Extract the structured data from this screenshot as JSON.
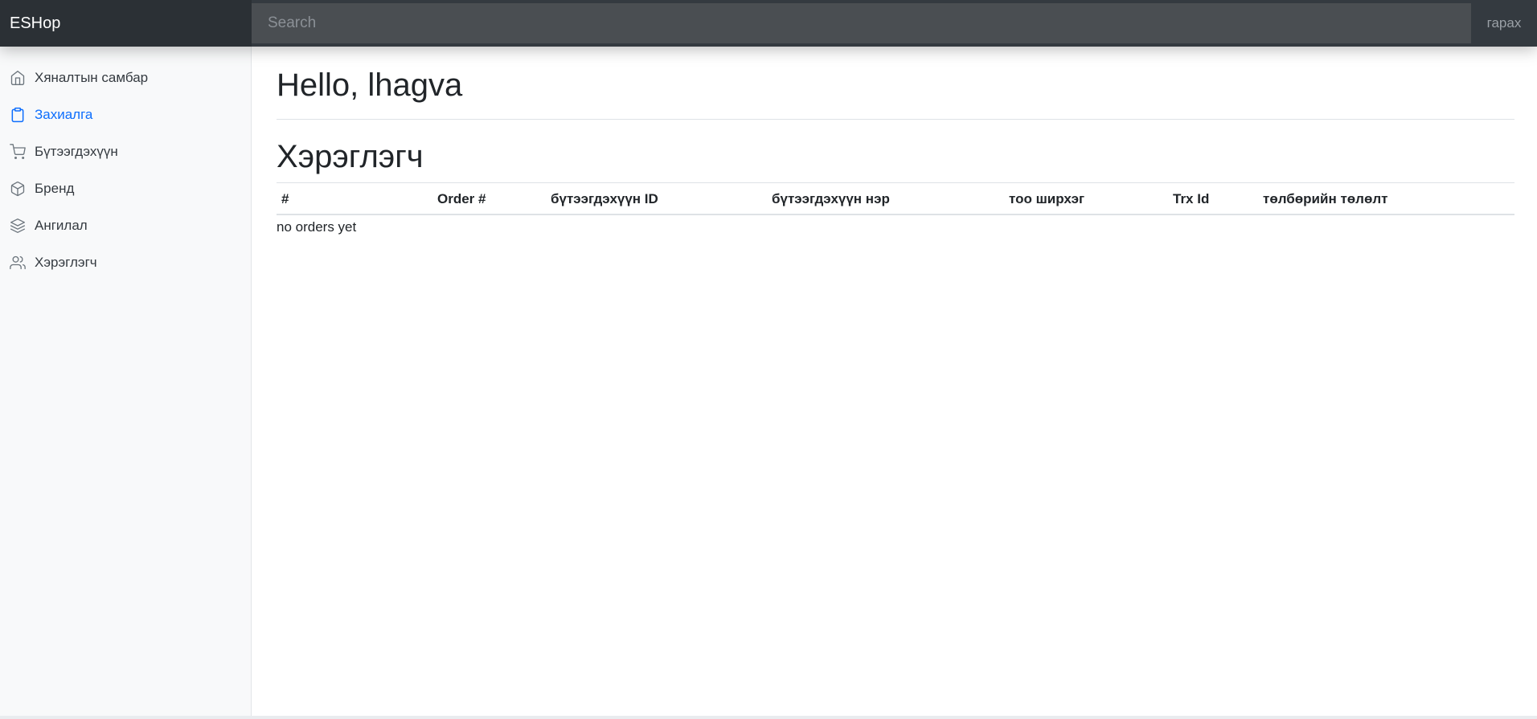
{
  "header": {
    "brand": "ESHop",
    "search_placeholder": "Search",
    "signout_label": "гарах"
  },
  "sidebar": {
    "items": [
      {
        "label": "Хяналтын самбар",
        "icon": "home-icon",
        "active": false
      },
      {
        "label": "Захиалга",
        "icon": "clipboard-icon",
        "active": true
      },
      {
        "label": "Бүтээгдэхүүн",
        "icon": "cart-icon",
        "active": false
      },
      {
        "label": "Бренд",
        "icon": "box-icon",
        "active": false
      },
      {
        "label": "Ангилал",
        "icon": "layers-icon",
        "active": false
      },
      {
        "label": "Хэрэглэгч",
        "icon": "users-icon",
        "active": false
      }
    ]
  },
  "main": {
    "greeting": "Hello, lhagva",
    "section_title": "Хэрэглэгч",
    "table": {
      "columns": [
        "#",
        "Order #",
        "бүтээгдэхүүн ID",
        "бүтээгдэхүүн нэр",
        "тоо ширхэг",
        "Trx Id",
        "төлбөрийн төлөлт"
      ],
      "empty_message": "no orders yet"
    }
  },
  "colors": {
    "topbar": "#343a40",
    "active": "#0d6efd",
    "sidebar_bg": "#f8f9fa"
  }
}
